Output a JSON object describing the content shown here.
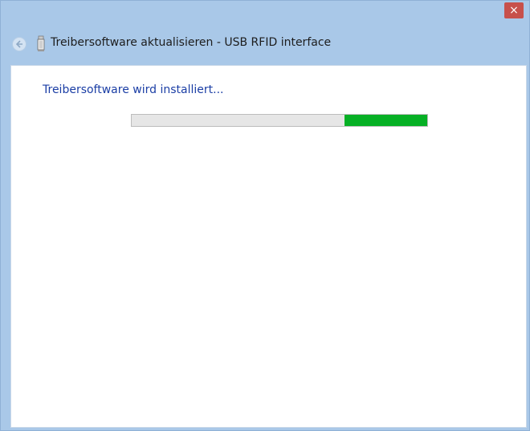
{
  "window": {
    "close_label": "×"
  },
  "header": {
    "title": "Treibersoftware aktualisieren - USB RFID interface",
    "back_icon": "back-arrow-icon",
    "device_icon": "usb-device-icon"
  },
  "content": {
    "status_text": "Treibersoftware wird installiert..."
  },
  "progress": {
    "style": "marquee",
    "indicator_start_fraction": 0.72,
    "indicator_length_fraction": 0.28,
    "fill_color": "#06b025",
    "track_color": "#e6e6e6"
  },
  "colors": {
    "frame": "#a9c8e8",
    "close_button": "#c7504b",
    "status_text": "#1b3ea5"
  }
}
